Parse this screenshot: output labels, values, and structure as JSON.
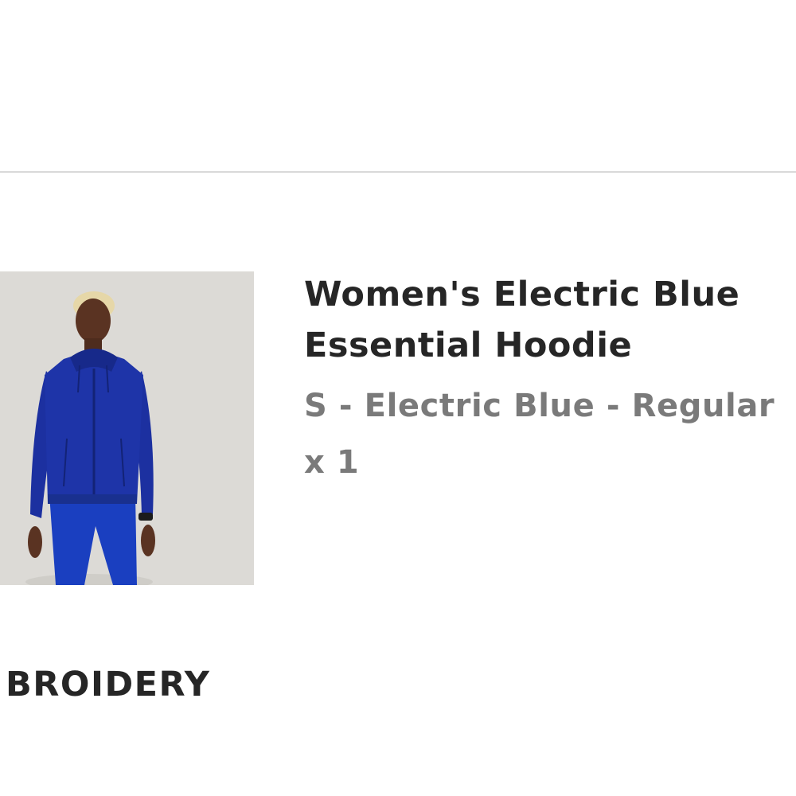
{
  "cart_item": {
    "image_alt": "Women's Electric Blue Essential Hoodie",
    "title_line1": "Women's Electric Blue",
    "title_line2": "Essential Hoodie",
    "variant": "S - Electric Blue - Regular",
    "quantity": "x 1",
    "image_colors": {
      "background": "#dcdad6",
      "hoodie": "#1e34a8",
      "pants": "#1a3fc0",
      "skin": "#5a3322",
      "hair": "#e6d7a8"
    }
  },
  "section": {
    "heading": "BROIDERY"
  }
}
